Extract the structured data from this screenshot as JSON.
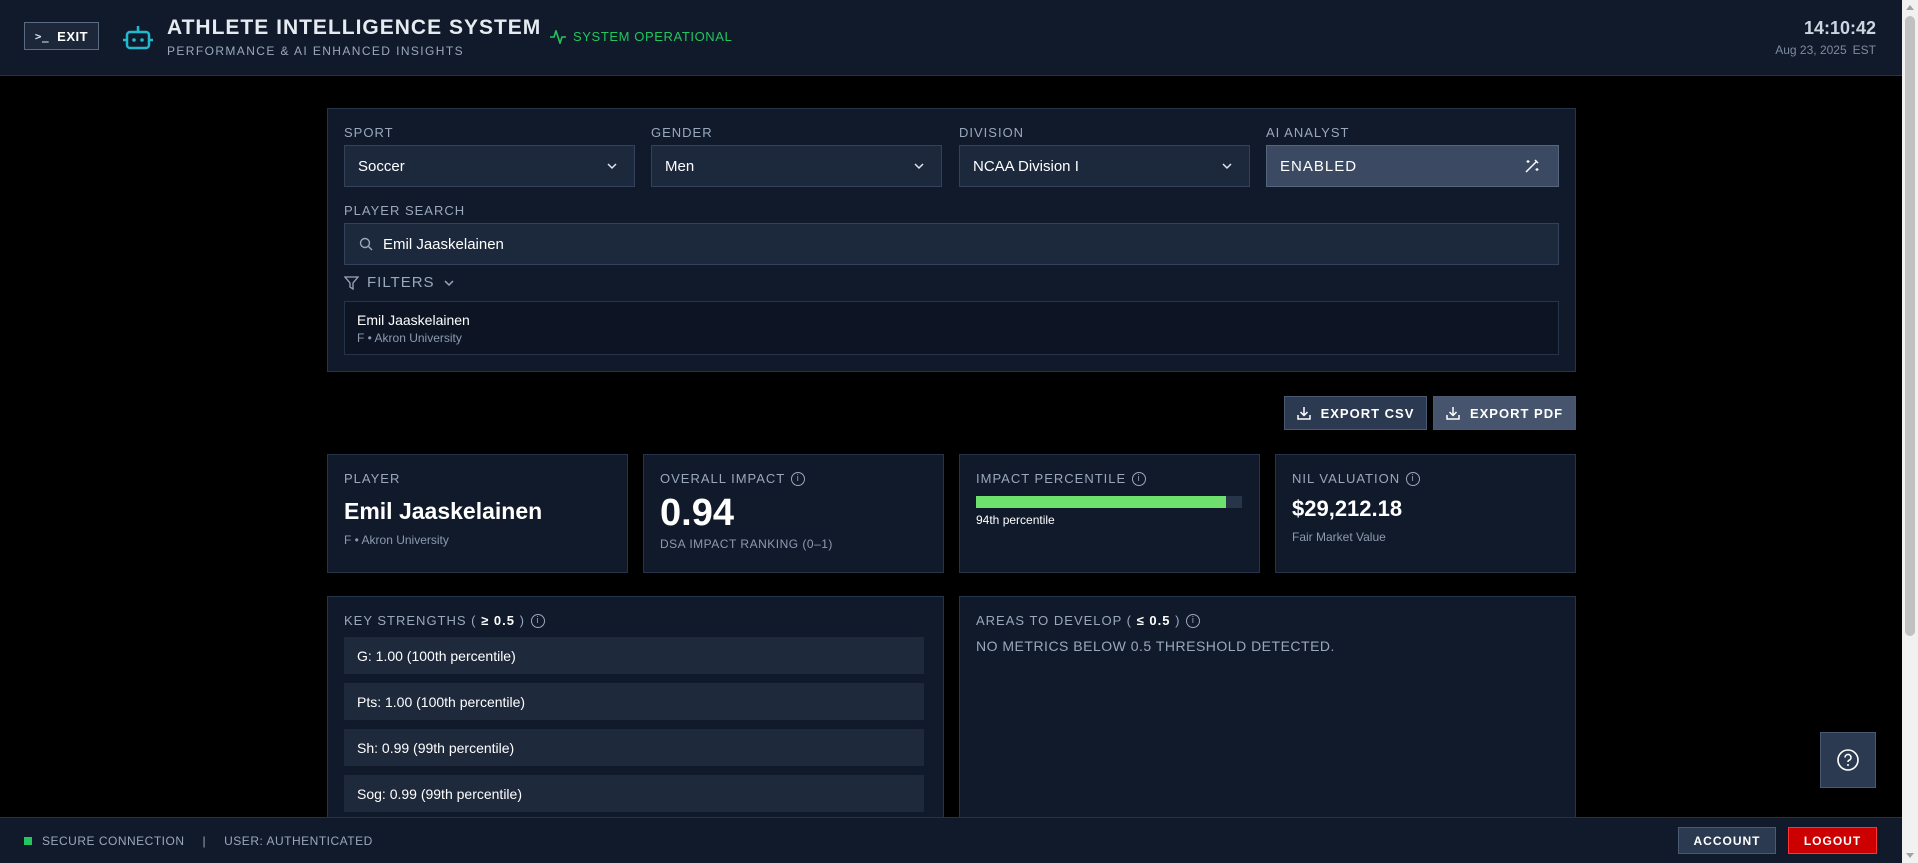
{
  "header": {
    "exit_label": "EXIT",
    "title": "ATHLETE INTELLIGENCE SYSTEM",
    "subtitle": "PERFORMANCE & AI ENHANCED INSIGHTS",
    "status": "SYSTEM OPERATIONAL",
    "time": "14:10:42",
    "date": "Aug 23, 2025",
    "timezone": "EST"
  },
  "filters": {
    "sport_label": "SPORT",
    "sport_value": "Soccer",
    "gender_label": "GENDER",
    "gender_value": "Men",
    "division_label": "DIVISION",
    "division_value": "NCAA Division I",
    "ai_label": "AI ANALYST",
    "ai_value": "ENABLED",
    "search_label": "PLAYER SEARCH",
    "search_value": "Emil Jaaskelainen",
    "filters_toggle": "FILTERS"
  },
  "search_result": {
    "name": "Emil Jaaskelainen",
    "meta": "F • Akron University"
  },
  "export": {
    "csv_label": "EXPORT CSV",
    "pdf_label": "EXPORT PDF"
  },
  "cards": {
    "player_label": "PLAYER",
    "player_name": "Emil Jaaskelainen",
    "player_meta": "F • Akron University",
    "impact_label": "OVERALL IMPACT",
    "impact_value": "0.94",
    "impact_sub": "DSA IMPACT RANKING (0–1)",
    "percentile_label": "IMPACT PERCENTILE",
    "percentile_value": 94,
    "percentile_text": "94th percentile",
    "nil_label": "NIL VALUATION",
    "nil_value": "$29,212.18",
    "nil_sub": "Fair Market Value"
  },
  "strengths": {
    "label_prefix": "KEY STRENGTHS (",
    "threshold": "≥ 0.5",
    "label_suffix": ")",
    "items": [
      "G: 1.00 (100th percentile)",
      "Pts: 1.00 (100th percentile)",
      "Sh: 0.99 (99th percentile)",
      "Sog: 0.99 (99th percentile)"
    ]
  },
  "develop": {
    "label_prefix": "AREAS TO DEVELOP (",
    "threshold": "≤ 0.5",
    "label_suffix": ")",
    "message": "NO METRICS BELOW 0.5 THRESHOLD DETECTED."
  },
  "footer": {
    "connection": "SECURE CONNECTION",
    "separator": "|",
    "user": "USER: AUTHENTICATED",
    "account_label": "ACCOUNT",
    "logout_label": "LOGOUT"
  },
  "colors": {
    "accent_green": "#22c55e",
    "progress_green": "#6ee06e",
    "logout_red": "#cc0000",
    "icon_cyan": "#22b8cf"
  }
}
